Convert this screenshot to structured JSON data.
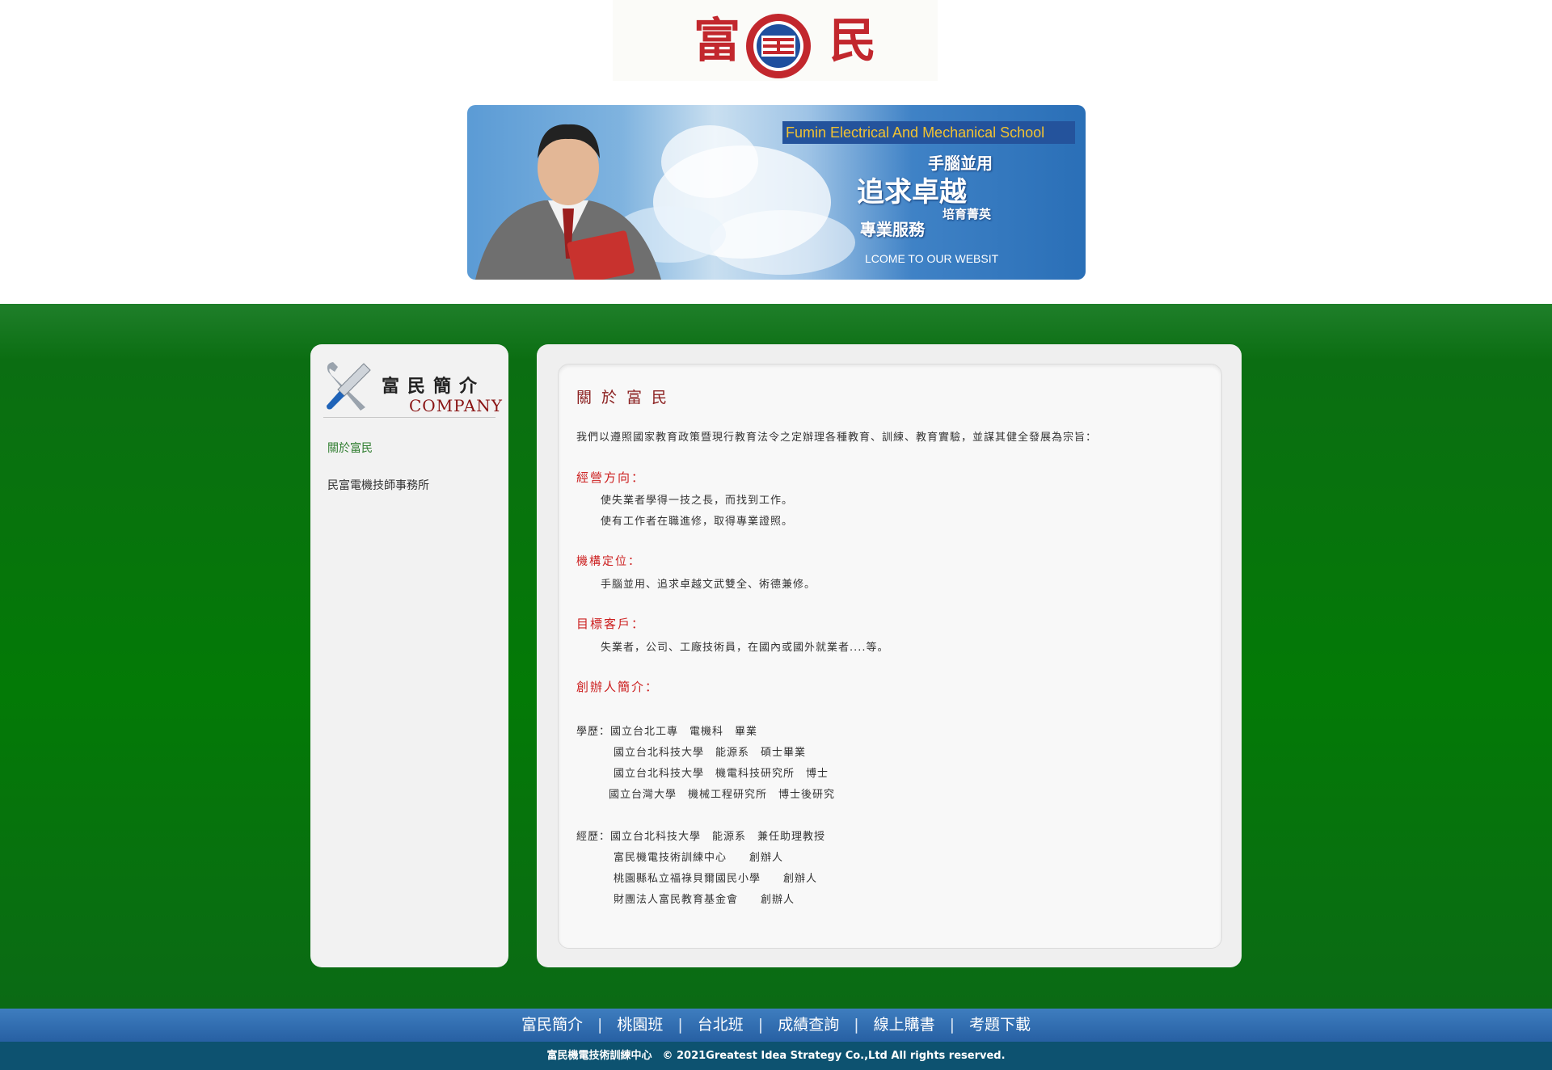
{
  "header": {
    "logo_left": "富",
    "logo_right": "民"
  },
  "banner": {
    "english": "Fumin Electrical And Mechanical School",
    "line1": "手腦並用",
    "line2": "追求卓越",
    "line3": "培育菁英",
    "line4": "專業服務",
    "welcome": "LCOME TO OUR WEBSIT"
  },
  "sidebar": {
    "title_zh": "富民簡介",
    "title_en": "COMPANY",
    "items": [
      {
        "label": "關於富民"
      },
      {
        "label": "民富電機技師事務所"
      }
    ]
  },
  "content": {
    "title": "關於富民",
    "intro": "我們以遵照國家教育政策暨現行教育法令之定辦理各種教育、訓練、教育實驗，並謀其健全發展為宗旨：",
    "sec1_heading": "經營方向：",
    "sec1_line1": "使失業者學得一技之長，而找到工作。",
    "sec1_line2": "使有工作者在職進修，取得專業證照。",
    "sec2_heading": "機構定位：",
    "sec2_line1": "手腦並用、追求卓越文武雙全、術德兼修。",
    "sec3_heading": "目標客戶：",
    "sec3_line1": "失業者，公司、工廠技術員，在國內或國外就業者....等。",
    "sec4_heading": "創辦人簡介：",
    "edu_1": "學歷：國立台北工專　電機科　畢業",
    "edu_2": "國立台北科技大學　能源系　碩士畢業",
    "edu_3": "國立台北科技大學　機電科技研究所　博士",
    "edu_4": "國立台灣大學　機械工程研究所　博士後研究",
    "exp_1": "經歷：國立台北科技大學　能源系　兼任助理教授",
    "exp_2": "富民機電技術訓練中心　　創辦人",
    "exp_3": "桃園縣私立福祿貝爾國民小學　　創辦人",
    "exp_4": "財團法人富民教育基金會　　創辦人"
  },
  "footer": {
    "nav": [
      "富民簡介",
      "桃園班",
      "台北班",
      "成績查詢",
      "線上購書",
      "考題下載"
    ],
    "separator": "|",
    "copyright": "富民機電技術訓練中心　© 2021Greatest Idea Strategy Co.,Ltd All rights reserved."
  },
  "colors": {
    "logo_red": "#c2272d",
    "green_band": "#037a06",
    "heading_red": "#cc1f1f",
    "nav_blue": "#2760a3",
    "footer_teal": "#0d5270"
  },
  "icons": [
    "school-emblem-icon",
    "tools-icon",
    "banner-photo"
  ]
}
